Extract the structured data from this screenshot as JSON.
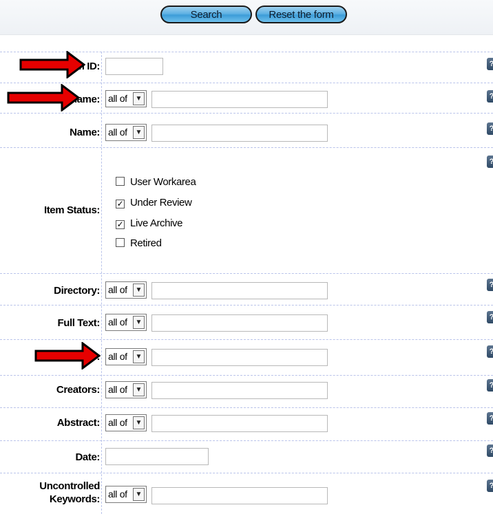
{
  "toolbar": {
    "search_label": "Search",
    "reset_label": "Reset the form"
  },
  "fields": {
    "item_id": {
      "label": "m ID:"
    },
    "username": {
      "label": "ername:",
      "mode": "all of"
    },
    "name": {
      "label": "Name:",
      "mode": "all of"
    },
    "item_status": {
      "label": "Item Status:",
      "options": [
        {
          "label": "User Workarea",
          "checked": false
        },
        {
          "label": "Under Review",
          "checked": true
        },
        {
          "label": "Live Archive",
          "checked": true
        },
        {
          "label": "Retired",
          "checked": false
        }
      ]
    },
    "directory": {
      "label": "Directory:",
      "mode": "all of"
    },
    "full_text": {
      "label": "Full Text:",
      "mode": "all of"
    },
    "title": {
      "label": ":",
      "mode": "all of"
    },
    "creators": {
      "label": "Creators:",
      "mode": "all of"
    },
    "abstract": {
      "label": "Abstract:",
      "mode": "all of"
    },
    "date": {
      "label": "Date:"
    },
    "keywords": {
      "label_line1": "Uncontrolled",
      "label_line2": "Keywords:",
      "mode": "all of"
    }
  },
  "help_glyph": "?",
  "colors": {
    "button": "#5fb2e4",
    "arrow": "#e60000",
    "divider": "#b9c3ea"
  },
  "icons": {
    "help": "help-icon",
    "annotation": "red-arrow-icon",
    "dropdown": "chevron-down-icon"
  }
}
